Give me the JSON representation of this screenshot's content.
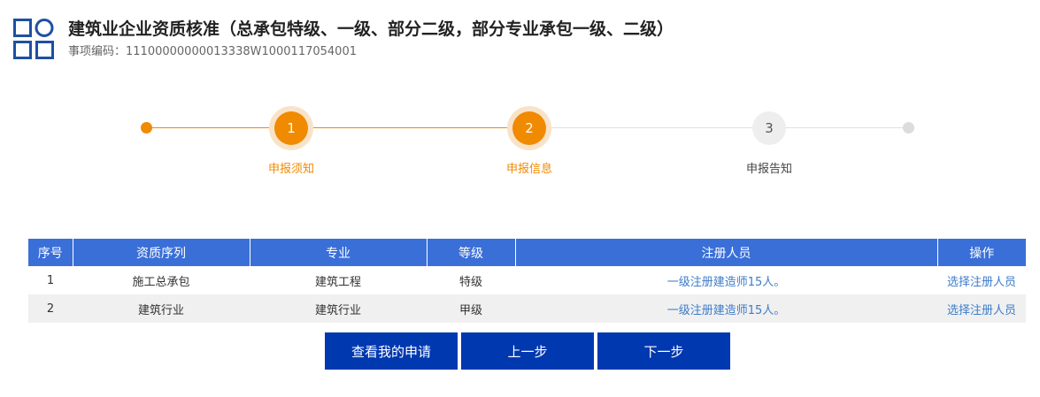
{
  "header": {
    "logo_icon": "grid-squares-circle-icon",
    "title": "建筑业企业资质核准（总承包特级、一级、部分二级，部分专业承包一级、二级）",
    "code_label": "事项编码：",
    "code_value": "11100000000013338W1000117054001"
  },
  "colors": {
    "accent_orange": "#f08a00",
    "table_header_blue": "#3a6fd8",
    "button_blue": "#0038b0",
    "link_blue": "#3d7cc9"
  },
  "steps": [
    {
      "number": "1",
      "label": "申报须知",
      "state": "completed"
    },
    {
      "number": "2",
      "label": "申报信息",
      "state": "current"
    },
    {
      "number": "3",
      "label": "申报告知",
      "state": "pending"
    }
  ],
  "table": {
    "headers": [
      "序号",
      "资质序列",
      "专业",
      "等级",
      "注册人员",
      "操作"
    ],
    "rows": [
      {
        "index": "1",
        "series": "施工总承包",
        "specialty": "建筑工程",
        "grade": "特级",
        "personnel": "一级注册建造师15人。",
        "action": "选择注册人员"
      },
      {
        "index": "2",
        "series": "建筑行业",
        "specialty": "建筑行业",
        "grade": "甲级",
        "personnel": "一级注册建造师15人。",
        "action": "选择注册人员"
      }
    ]
  },
  "buttons": {
    "view_application": "查看我的申请",
    "previous": "上一步",
    "next": "下一步"
  }
}
